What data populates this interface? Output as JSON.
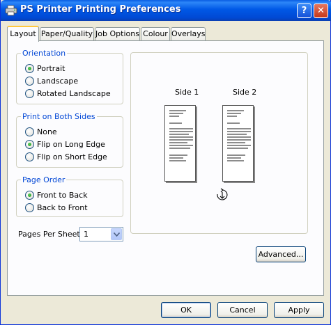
{
  "window": {
    "title": "PS Printer Printing Preferences",
    "help_label": "?",
    "close_label": "✕"
  },
  "tabs": [
    {
      "label": "Layout",
      "active": true
    },
    {
      "label": "Paper/Quality",
      "active": false
    },
    {
      "label": "Job Options",
      "active": false
    },
    {
      "label": "Colour",
      "active": false
    },
    {
      "label": "Overlays",
      "active": false
    }
  ],
  "orientation": {
    "legend": "Orientation",
    "options": [
      {
        "label": "Portrait",
        "selected": true
      },
      {
        "label": "Landscape",
        "selected": false
      },
      {
        "label": "Rotated Landscape",
        "selected": false
      }
    ]
  },
  "both_sides": {
    "legend": "Print on Both Sides",
    "options": [
      {
        "label": "None",
        "selected": false
      },
      {
        "label": "Flip on Long Edge",
        "selected": true
      },
      {
        "label": "Flip on Short Edge",
        "selected": false
      }
    ]
  },
  "page_order": {
    "legend": "Page Order",
    "options": [
      {
        "label": "Front to Back",
        "selected": true
      },
      {
        "label": "Back to Front",
        "selected": false
      }
    ]
  },
  "pages_per_sheet": {
    "label": "Pages Per Sheet:",
    "value": "1"
  },
  "preview": {
    "side1": "Side 1",
    "side2": "Side 2"
  },
  "buttons": {
    "advanced": "Advanced...",
    "ok": "OK",
    "cancel": "Cancel",
    "apply": "Apply"
  },
  "colors": {
    "title_bar": "#0058E6",
    "legend_text": "#0046D5",
    "dialog_bg": "#ECE9D8",
    "selected_radio": "#1E8A1E"
  }
}
